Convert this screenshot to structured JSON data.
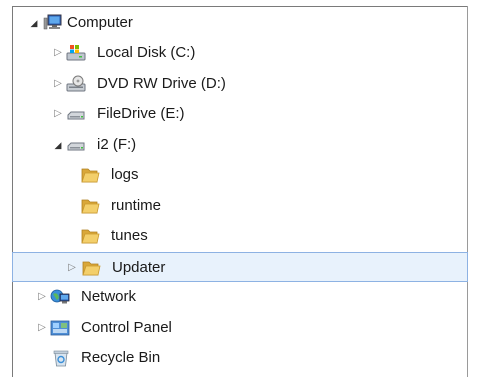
{
  "tree": {
    "computer": {
      "label": "Computer",
      "expanded": true
    },
    "local_disk": {
      "label": "Local Disk (C:)"
    },
    "dvd_drive": {
      "label": "DVD RW Drive (D:)"
    },
    "file_drive": {
      "label": "FileDrive (E:)"
    },
    "i2_drive": {
      "label": "i2 (F:)",
      "expanded": true
    },
    "logs": {
      "label": "logs"
    },
    "runtime": {
      "label": "runtime"
    },
    "tunes": {
      "label": "tunes"
    },
    "updater": {
      "label": "Updater",
      "selected": true
    },
    "network": {
      "label": "Network"
    },
    "control_panel": {
      "label": "Control Panel"
    },
    "recycle_bin": {
      "label": "Recycle Bin"
    }
  },
  "colors": {
    "selection_bg": "#e8f2fc",
    "selection_border": "#8db2e3",
    "folder_yellow": "#e8b84a"
  }
}
